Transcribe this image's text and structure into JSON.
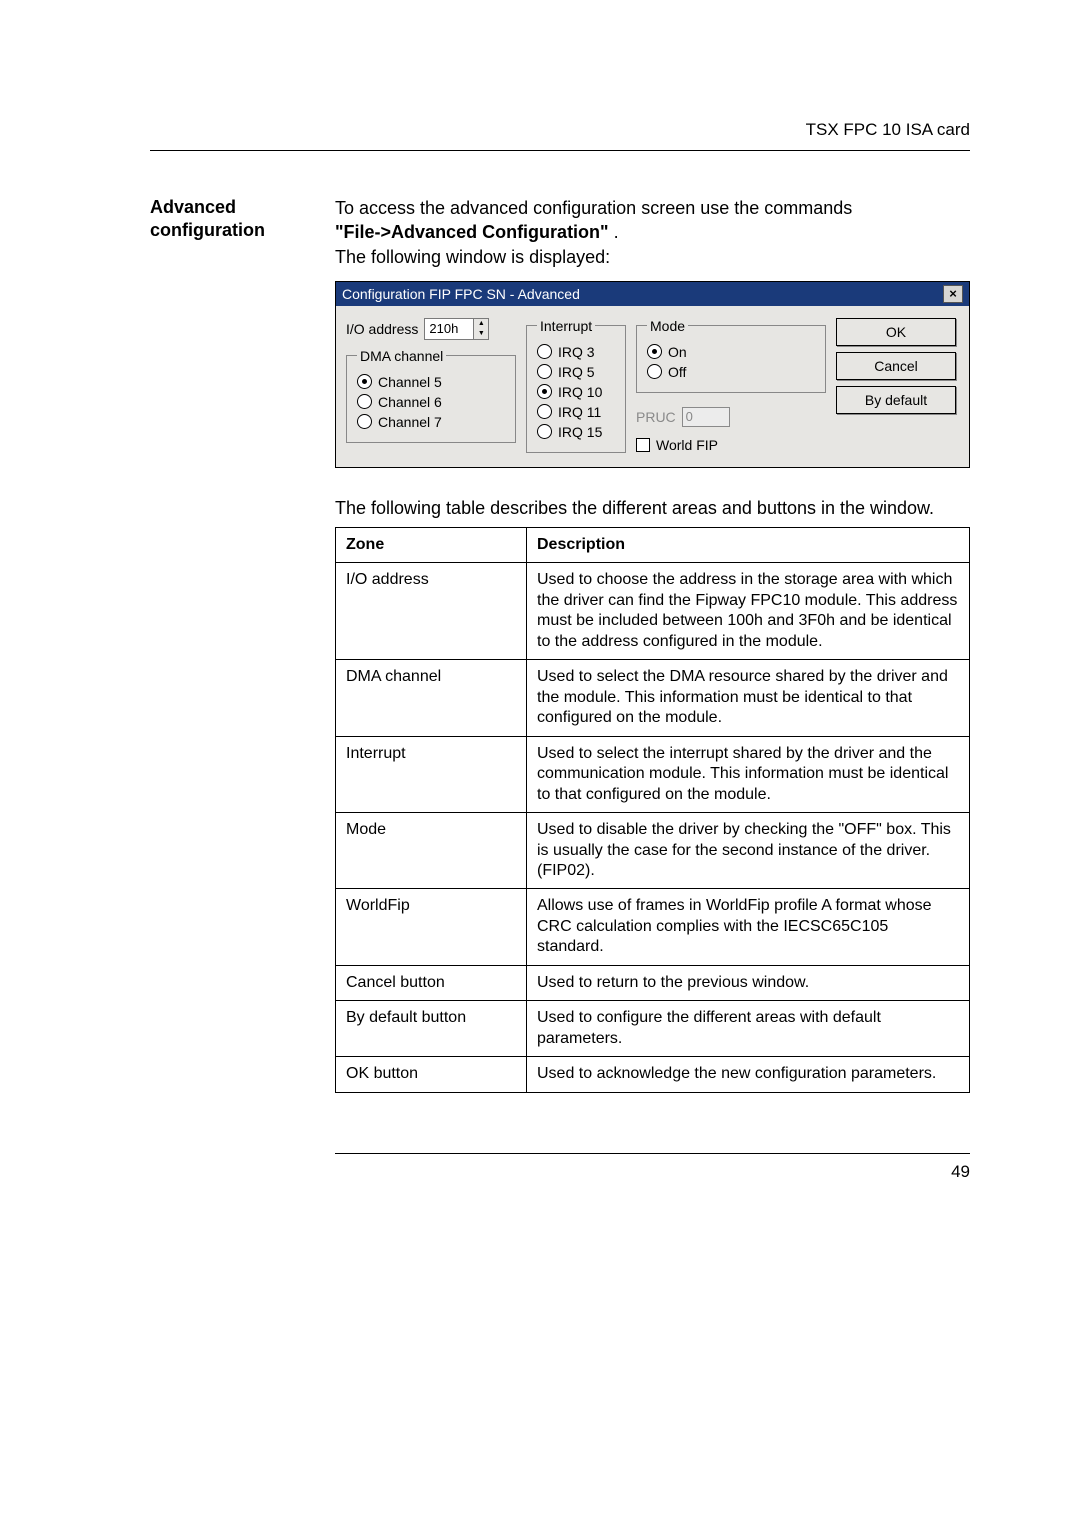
{
  "header": {
    "doc_title": "TSX FPC 10 ISA card"
  },
  "sidebar": {
    "heading_line1": "Advanced",
    "heading_line2": "configuration"
  },
  "intro": {
    "line1": "To access the advanced configuration screen use the commands",
    "cmd": "\"File->Advanced Configuration\"",
    "period": " .",
    "line2": "The following window is displayed:"
  },
  "dialog": {
    "title": "Configuration FIP FPC SN - Advanced",
    "io_label": "I/O address",
    "io_value": "210h",
    "dma_legend": "DMA channel",
    "dma": [
      {
        "label": "Channel 5",
        "checked": true
      },
      {
        "label": "Channel 6",
        "checked": false
      },
      {
        "label": "Channel 7",
        "checked": false
      }
    ],
    "interrupt_legend": "Interrupt",
    "interrupt": [
      {
        "label": "IRQ 3",
        "checked": false
      },
      {
        "label": "IRQ 5",
        "checked": false
      },
      {
        "label": "IRQ 10",
        "checked": true
      },
      {
        "label": "IRQ 11",
        "checked": false
      },
      {
        "label": "IRQ 15",
        "checked": false
      }
    ],
    "mode_legend": "Mode",
    "mode": [
      {
        "label": "On",
        "checked": true
      },
      {
        "label": "Off",
        "checked": false
      }
    ],
    "pruc_label": "PRUC",
    "pruc_value": "0",
    "worldfip_label": "World FIP",
    "buttons": {
      "ok": "OK",
      "cancel": "Cancel",
      "default": "By default"
    }
  },
  "table_caption": "The following table describes the different areas and buttons in the window.",
  "table": {
    "headers": {
      "zone": "Zone",
      "desc": "Description"
    },
    "rows": [
      {
        "zone": "I/O address",
        "desc": "Used to choose the address in the storage area with which the driver can find the Fipway FPC10 module. This address must be included between 100h and 3F0h and be identical to the address configured in the module."
      },
      {
        "zone": "DMA channel",
        "desc": "Used to select the DMA resource shared by the driver and the module. This information must be identical to that configured on the module."
      },
      {
        "zone": "Interrupt",
        "desc": "Used to select the interrupt shared by the driver and the communication module. This information must be identical to that configured on the module."
      },
      {
        "zone": "Mode",
        "desc": "Used to disable the driver by checking the \"OFF\" box. This is usually the case for the second instance of the driver. (FIP02)."
      },
      {
        "zone": "WorldFip",
        "desc": "Allows use of frames in WorldFip profile A format whose CRC calculation complies with the IECSC65C105 standard."
      },
      {
        "zone": "Cancel button",
        "desc": "Used to return to the previous window."
      },
      {
        "zone": "By default button",
        "desc": "Used to configure the different areas with default parameters."
      },
      {
        "zone": "OK button",
        "desc": "Used to acknowledge the new configuration parameters."
      }
    ]
  },
  "page_number": "49"
}
